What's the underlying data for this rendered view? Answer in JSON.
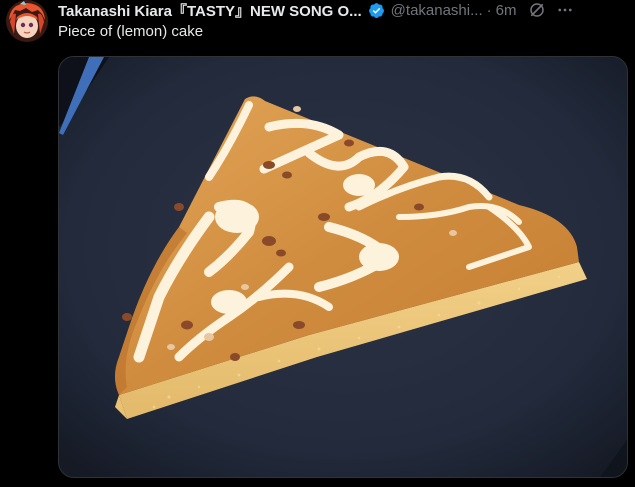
{
  "tweet": {
    "author_name": "Takanashi Kiara『TASTY』NEW SONG O...",
    "handle": "@takanashi...",
    "separator": "·",
    "time": "6m",
    "text": "Piece of (lemon) cake",
    "avatar_icon": "avatar-image",
    "verified_icon": "verified-badge-icon",
    "grok_icon": "grok-icon",
    "more_icon": "more-options-icon"
  },
  "colors": {
    "background": "#000000",
    "text_primary": "#e7e9ea",
    "text_secondary": "#71767b",
    "verified_blue": "#1d9bf0"
  },
  "media": {
    "type": "photo",
    "subject": "cake-slice"
  }
}
